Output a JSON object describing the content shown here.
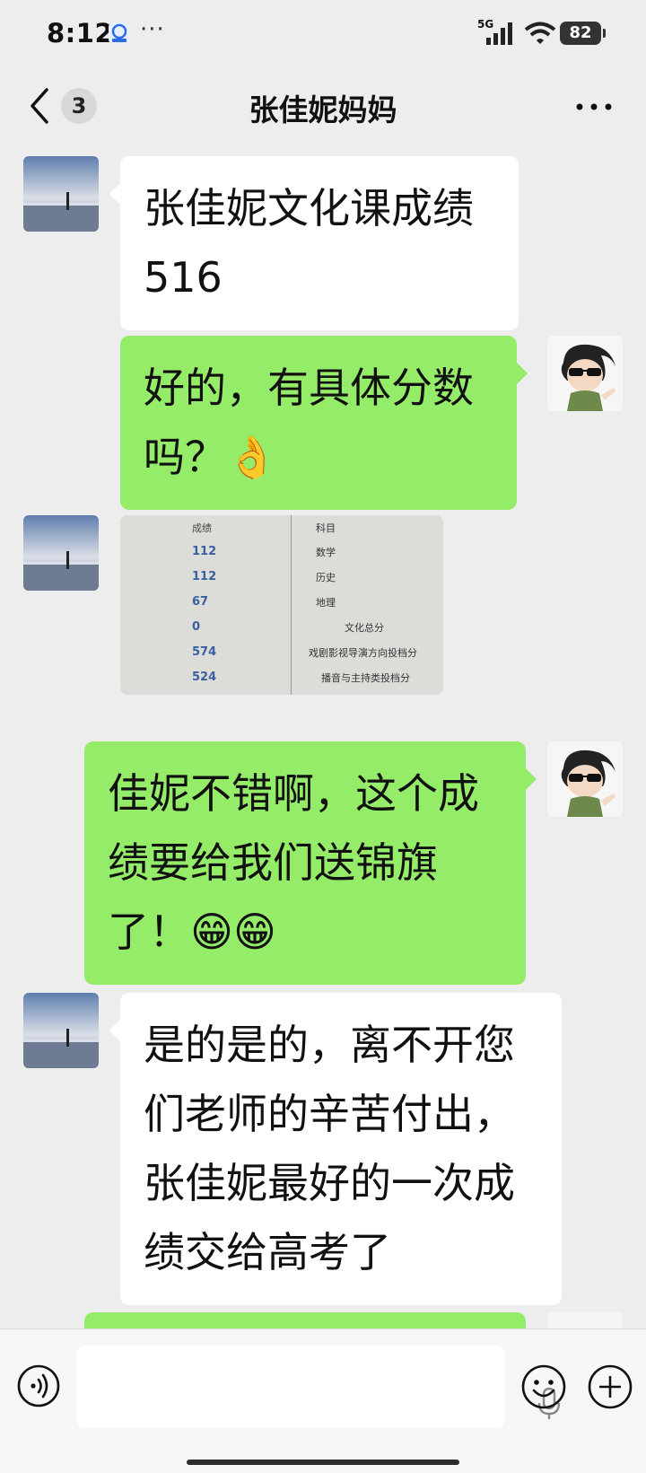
{
  "status_bar": {
    "time": "8:12",
    "dots": "···",
    "network": "5G",
    "battery": "82"
  },
  "header": {
    "unread_count": "3",
    "title": "张佳妮妈妈"
  },
  "messages": [
    {
      "side": "left",
      "type": "text",
      "text": "张佳妮文化课成绩516"
    },
    {
      "side": "right",
      "type": "text",
      "text": "好的，有具体分数吗？👌"
    },
    {
      "side": "left",
      "type": "image",
      "table": {
        "headers": {
          "score": "成绩",
          "subject": "科目"
        },
        "rows": [
          {
            "score": "112",
            "subject": "数学"
          },
          {
            "score": "112",
            "subject": "历史"
          },
          {
            "score": "67",
            "subject": "地理"
          },
          {
            "score": "0",
            "subject": "文化总分"
          },
          {
            "score": "574",
            "subject": "戏剧影视导演方向投档分"
          },
          {
            "score": "524",
            "subject": "播音与主持类投档分"
          }
        ]
      }
    },
    {
      "side": "right",
      "type": "text",
      "text": "佳妮不错啊，这个成绩要给我们送锦旗了！😁😁"
    },
    {
      "side": "left",
      "type": "text",
      "text": "是的是的，离不开您们老师的辛苦付出，张佳妮最好的一次成绩交给高考了"
    }
  ],
  "colors": {
    "background": "#ededed",
    "bubble_self": "#95ec69",
    "bubble_other": "#ffffff"
  }
}
